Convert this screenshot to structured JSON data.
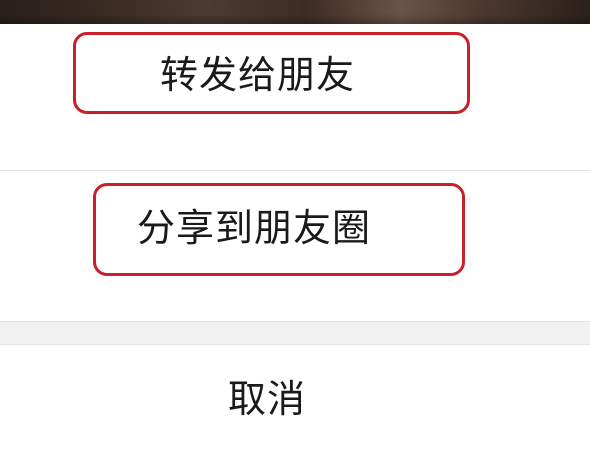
{
  "share_sheet": {
    "forward_label": "转发给朋友",
    "moments_label": "分享到朋友圈",
    "cancel_label": "取消"
  },
  "colors": {
    "highlight_border": "#c8202a",
    "gap_band": "#f1f1f1",
    "divider": "#e1e1e1",
    "text": "#1a1a1a"
  }
}
